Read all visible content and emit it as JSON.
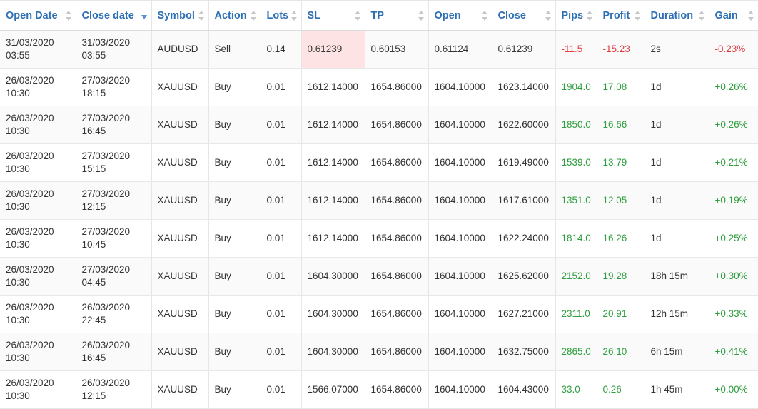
{
  "columns": [
    {
      "label": "Open Date",
      "sort": "both"
    },
    {
      "label": "Close date",
      "sort": "desc"
    },
    {
      "label": "Symbol",
      "sort": "both"
    },
    {
      "label": "Action",
      "sort": "both"
    },
    {
      "label": "Lots",
      "sort": "both"
    },
    {
      "label": "SL",
      "sort": "both"
    },
    {
      "label": "TP",
      "sort": "both"
    },
    {
      "label": "Open",
      "sort": "both"
    },
    {
      "label": "Close",
      "sort": "both"
    },
    {
      "label": "Pips",
      "sort": "both"
    },
    {
      "label": "Profit",
      "sort": "both"
    },
    {
      "label": "Duration",
      "sort": "both"
    },
    {
      "label": "Gain",
      "sort": "both"
    }
  ],
  "rows": [
    {
      "open_date": "31/03/2020",
      "open_time": "03:55",
      "close_date": "31/03/2020",
      "close_time": "03:55",
      "symbol": "AUDUSD",
      "action": "Sell",
      "lots": "0.14",
      "sl": "0.61239",
      "sl_hit": true,
      "tp": "0.60153",
      "open": "0.61124",
      "close": "0.61239",
      "pips": "-11.5",
      "profit": "-15.23",
      "duration": "2s",
      "gain": "-0.23%",
      "result": "neg"
    },
    {
      "open_date": "26/03/2020",
      "open_time": "10:30",
      "close_date": "27/03/2020",
      "close_time": "18:15",
      "symbol": "XAUUSD",
      "action": "Buy",
      "lots": "0.01",
      "sl": "1612.14000",
      "sl_hit": false,
      "tp": "1654.86000",
      "open": "1604.10000",
      "close": "1623.14000",
      "pips": "1904.0",
      "profit": "17.08",
      "duration": "1d",
      "gain": "+0.26%",
      "result": "pos"
    },
    {
      "open_date": "26/03/2020",
      "open_time": "10:30",
      "close_date": "27/03/2020",
      "close_time": "16:45",
      "symbol": "XAUUSD",
      "action": "Buy",
      "lots": "0.01",
      "sl": "1612.14000",
      "sl_hit": false,
      "tp": "1654.86000",
      "open": "1604.10000",
      "close": "1622.60000",
      "pips": "1850.0",
      "profit": "16.66",
      "duration": "1d",
      "gain": "+0.26%",
      "result": "pos"
    },
    {
      "open_date": "26/03/2020",
      "open_time": "10:30",
      "close_date": "27/03/2020",
      "close_time": "15:15",
      "symbol": "XAUUSD",
      "action": "Buy",
      "lots": "0.01",
      "sl": "1612.14000",
      "sl_hit": false,
      "tp": "1654.86000",
      "open": "1604.10000",
      "close": "1619.49000",
      "pips": "1539.0",
      "profit": "13.79",
      "duration": "1d",
      "gain": "+0.21%",
      "result": "pos"
    },
    {
      "open_date": "26/03/2020",
      "open_time": "10:30",
      "close_date": "27/03/2020",
      "close_time": "12:15",
      "symbol": "XAUUSD",
      "action": "Buy",
      "lots": "0.01",
      "sl": "1612.14000",
      "sl_hit": false,
      "tp": "1654.86000",
      "open": "1604.10000",
      "close": "1617.61000",
      "pips": "1351.0",
      "profit": "12.05",
      "duration": "1d",
      "gain": "+0.19%",
      "result": "pos"
    },
    {
      "open_date": "26/03/2020",
      "open_time": "10:30",
      "close_date": "27/03/2020",
      "close_time": "10:45",
      "symbol": "XAUUSD",
      "action": "Buy",
      "lots": "0.01",
      "sl": "1612.14000",
      "sl_hit": false,
      "tp": "1654.86000",
      "open": "1604.10000",
      "close": "1622.24000",
      "pips": "1814.0",
      "profit": "16.26",
      "duration": "1d",
      "gain": "+0.25%",
      "result": "pos"
    },
    {
      "open_date": "26/03/2020",
      "open_time": "10:30",
      "close_date": "27/03/2020",
      "close_time": "04:45",
      "symbol": "XAUUSD",
      "action": "Buy",
      "lots": "0.01",
      "sl": "1604.30000",
      "sl_hit": false,
      "tp": "1654.86000",
      "open": "1604.10000",
      "close": "1625.62000",
      "pips": "2152.0",
      "profit": "19.28",
      "duration": "18h 15m",
      "gain": "+0.30%",
      "result": "pos"
    },
    {
      "open_date": "26/03/2020",
      "open_time": "10:30",
      "close_date": "26/03/2020",
      "close_time": "22:45",
      "symbol": "XAUUSD",
      "action": "Buy",
      "lots": "0.01",
      "sl": "1604.30000",
      "sl_hit": false,
      "tp": "1654.86000",
      "open": "1604.10000",
      "close": "1627.21000",
      "pips": "2311.0",
      "profit": "20.91",
      "duration": "12h 15m",
      "gain": "+0.33%",
      "result": "pos"
    },
    {
      "open_date": "26/03/2020",
      "open_time": "10:30",
      "close_date": "26/03/2020",
      "close_time": "16:45",
      "symbol": "XAUUSD",
      "action": "Buy",
      "lots": "0.01",
      "sl": "1604.30000",
      "sl_hit": false,
      "tp": "1654.86000",
      "open": "1604.10000",
      "close": "1632.75000",
      "pips": "2865.0",
      "profit": "26.10",
      "duration": "6h 15m",
      "gain": "+0.41%",
      "result": "pos"
    },
    {
      "open_date": "26/03/2020",
      "open_time": "10:30",
      "close_date": "26/03/2020",
      "close_time": "12:15",
      "symbol": "XAUUSD",
      "action": "Buy",
      "lots": "0.01",
      "sl": "1566.07000",
      "sl_hit": false,
      "tp": "1654.86000",
      "open": "1604.10000",
      "close": "1604.43000",
      "pips": "33.0",
      "profit": "0.26",
      "duration": "1h 45m",
      "gain": "+0.00%",
      "result": "pos"
    }
  ],
  "colors": {
    "header_text": "#2d6fb3",
    "positive": "#2e9e3e",
    "negative": "#e0383e",
    "sl_hit_bg": "#fde3e3"
  }
}
